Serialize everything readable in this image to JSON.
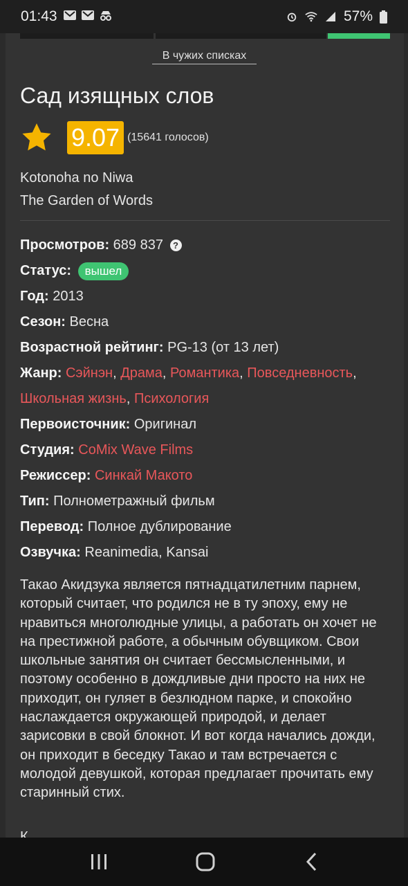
{
  "status_bar": {
    "time": "01:43",
    "battery": "57%"
  },
  "tabs_remnant": {
    "active_color": "#3fc472"
  },
  "others_lists_link": "В чужих списках",
  "title": "Сад изящных слов",
  "rating": {
    "score": "9.07",
    "votes": "(15641 голосов)",
    "star_color": "#f5b400"
  },
  "alt_names": [
    "Kotonoha no Niwa",
    "The Garden of Words"
  ],
  "info": {
    "views": {
      "label": "Просмотров:",
      "value": "689 837",
      "help": "?"
    },
    "status": {
      "label": "Статус:",
      "value": "вышел"
    },
    "year": {
      "label": "Год:",
      "value": "2013"
    },
    "season": {
      "label": "Сезон:",
      "value": "Весна"
    },
    "age_rating": {
      "label": "Возрастной рейтинг:",
      "value": "PG-13 (от 13 лет)"
    },
    "genre": {
      "label": "Жанр:",
      "items": [
        "Сэйнэн",
        "Драма",
        "Романтика",
        "Повседневность",
        "Школьная жизнь",
        "Психология"
      ]
    },
    "source": {
      "label": "Первоисточник:",
      "value": "Оригинал"
    },
    "studio": {
      "label": "Студия:",
      "value": "CoMix Wave Films"
    },
    "director": {
      "label": "Режиссер:",
      "value": "Синкай Макото"
    },
    "type": {
      "label": "Тип:",
      "value": "Полнометражный фильм"
    },
    "translation": {
      "label": "Перевод:",
      "value": "Полное дублирование"
    },
    "voiceover": {
      "label": "Озвучка:",
      "value": "Reanimedia, Kansai"
    }
  },
  "description": "Такао Акидзука является пятнадцатилетним парнем, который считает, что родился не в ту эпоху, ему не нравиться многолюдные улицы, а работать он хочет не на престижной работе, а обычным обувщиком. Свои школьные занятия он считает бессмысленными, и поэтому особенно в дождливые дни просто на них не приходит, он гуляет в безлюдном парке, и спокойно наслаждается окружающей природой, и делает зарисовки в свой блокнот. И вот когда начались дожди, он приходит в беседку Такао и там встречается с молодой девушкой, которая предлагает прочитать ему старинный стих.",
  "description_cut": "К",
  "colors": {
    "link": "#e8575a",
    "accent_green": "#3fc472",
    "background": "#333333"
  }
}
